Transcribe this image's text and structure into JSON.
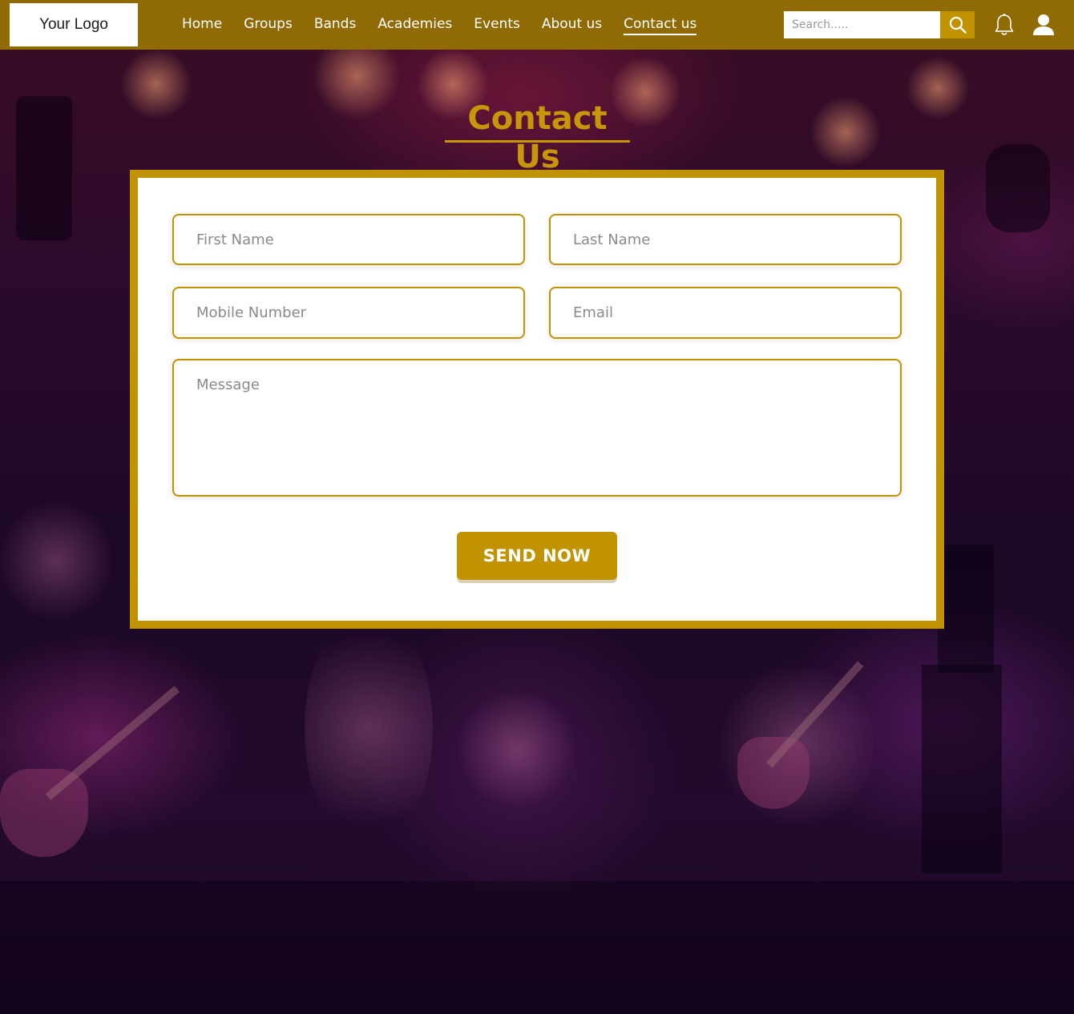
{
  "header": {
    "logo_text": "Your Logo",
    "nav": [
      {
        "label": "Home"
      },
      {
        "label": "Groups"
      },
      {
        "label": "Bands"
      },
      {
        "label": "Academies"
      },
      {
        "label": "Events"
      },
      {
        "label": "About us"
      },
      {
        "label": "Contact us",
        "active": true
      }
    ],
    "search": {
      "placeholder": "Search.....",
      "icon": "search-icon"
    },
    "icons": [
      "bell-icon",
      "user-icon"
    ],
    "color": "#8f6a05"
  },
  "main": {
    "title": "Contact Us",
    "title_color": "#c8960a",
    "form": {
      "first_name_placeholder": "First Name",
      "last_name_placeholder": "Last Name",
      "mobile_placeholder": "Mobile Number",
      "email_placeholder": "Email",
      "message_placeholder": "Message",
      "submit_label": "SEND NOW",
      "accent_color": "#c29300"
    }
  }
}
